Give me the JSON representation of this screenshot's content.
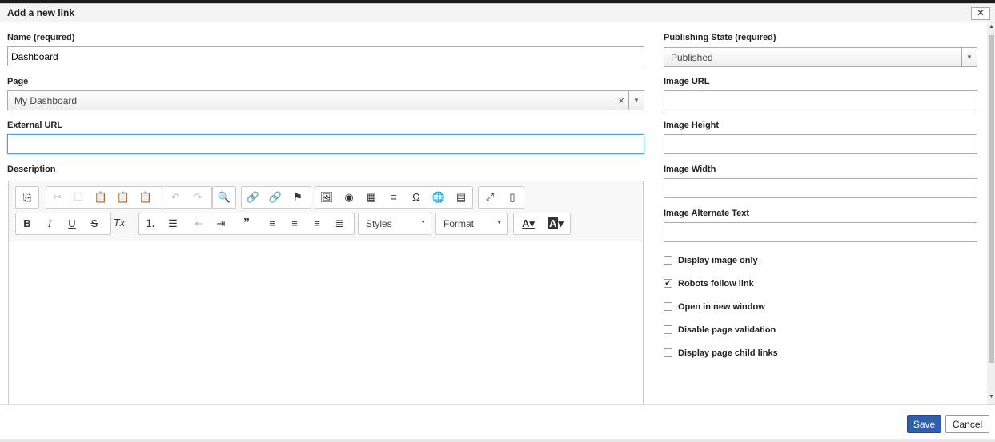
{
  "dialog": {
    "title": "Add a new link",
    "close_glyph": "✕"
  },
  "form": {
    "name": {
      "label": "Name (required)",
      "value": "Dashboard"
    },
    "page": {
      "label": "Page",
      "value": "My Dashboard",
      "clear_glyph": "×"
    },
    "external_url": {
      "label": "External URL",
      "value": ""
    },
    "description": {
      "label": "Description"
    },
    "publishing_state": {
      "label": "Publishing State (required)",
      "value": "Published"
    },
    "image_url": {
      "label": "Image URL",
      "value": ""
    },
    "image_height": {
      "label": "Image Height",
      "value": ""
    },
    "image_width": {
      "label": "Image Width",
      "value": ""
    },
    "image_alt": {
      "label": "Image Alternate Text",
      "value": ""
    },
    "checkboxes": [
      {
        "label": "Display image only",
        "checked": false
      },
      {
        "label": "Robots follow link",
        "checked": true
      },
      {
        "label": "Open in new window",
        "checked": false
      },
      {
        "label": "Disable page validation",
        "checked": false
      },
      {
        "label": "Display page child links",
        "checked": false
      }
    ]
  },
  "editor": {
    "styles_label": "Styles",
    "format_label": "Format"
  },
  "footer": {
    "save_label": "Save",
    "cancel_label": "Cancel"
  },
  "colors": {
    "accent": "#2f5fa8",
    "focus": "#5b9dd9"
  }
}
